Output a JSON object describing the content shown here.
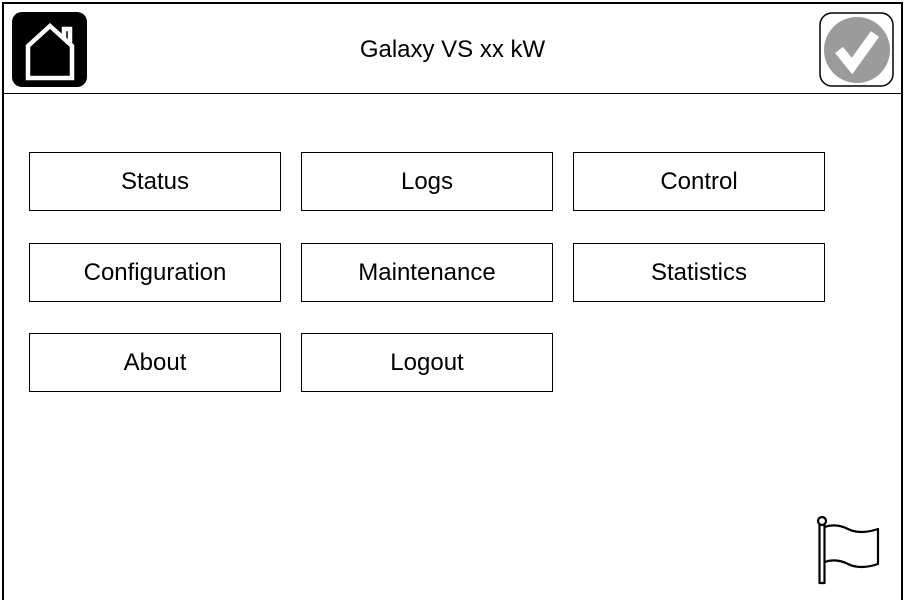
{
  "header": {
    "title": "Galaxy VS xx kW",
    "home_icon": "home-icon",
    "status_icon": "check-status-icon",
    "status_color": "#9b9b9b"
  },
  "menu": {
    "items": [
      {
        "label": "Status"
      },
      {
        "label": "Logs"
      },
      {
        "label": "Control"
      },
      {
        "label": "Configuration"
      },
      {
        "label": "Maintenance"
      },
      {
        "label": "Statistics"
      },
      {
        "label": "About"
      },
      {
        "label": "Logout"
      }
    ]
  },
  "footer": {
    "flag_icon": "flag-icon"
  }
}
